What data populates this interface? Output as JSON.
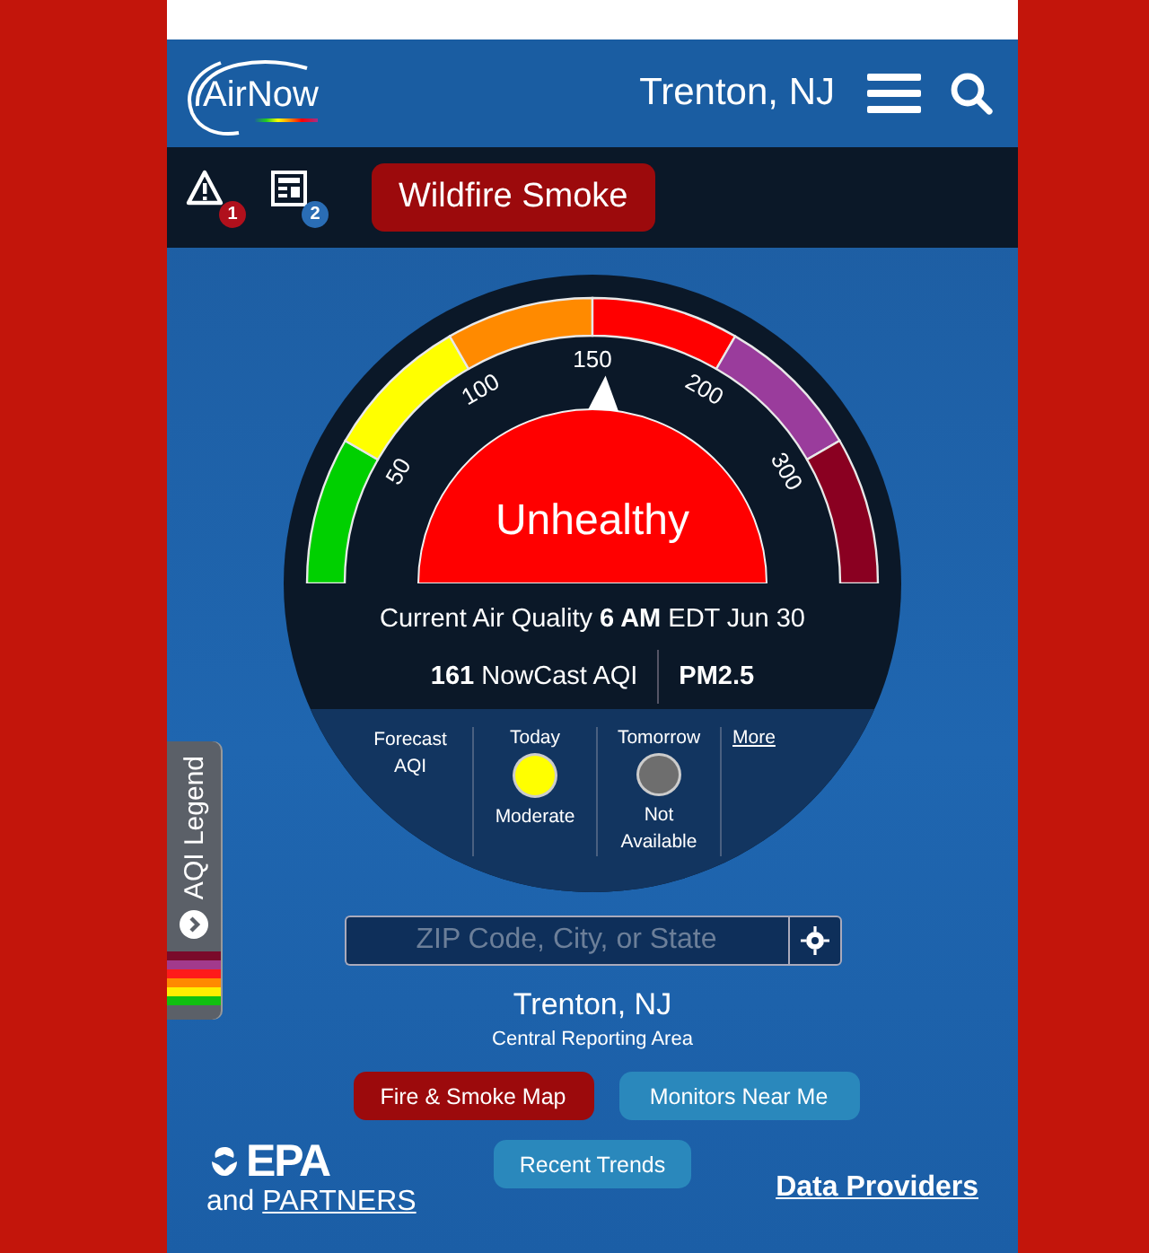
{
  "header": {
    "logo": "AirNow",
    "location": "Trenton, NJ"
  },
  "alerts": [
    {
      "kind": "warning",
      "count": "1",
      "color": "#b0101c"
    },
    {
      "kind": "notice",
      "count": "2",
      "color": "#2a6db5"
    }
  ],
  "banner_button": "Wildfire Smoke",
  "gauge": {
    "level": 0.52,
    "segments": [
      {
        "color": "#00d000"
      },
      {
        "color": "#ffff00"
      },
      {
        "color": "#ff8a00"
      },
      {
        "color": "#ff0000"
      },
      {
        "color": "#9a3c9c"
      },
      {
        "color": "#8a0021"
      }
    ],
    "ticks": [
      "50",
      "100",
      "150",
      "200",
      "300"
    ],
    "category": "Unhealthy"
  },
  "current": {
    "line": "Current Air Quality **6 AM** EDT Jun 30",
    "aqi": "**161** NowCast AQI",
    "pollutant": "PM2.5"
  },
  "forecast": {
    "title": "Forecast AQI",
    "days": [
      {
        "day": "Today",
        "color": "#ffff00",
        "category": "Moderate"
      },
      {
        "day": "Tomorrow",
        "color": "#6e6e6e",
        "category": "Not Available"
      }
    ],
    "more": "More"
  },
  "legend_tab": {
    "label": "AQI Legend",
    "colors": [
      {
        "color": "#7a0a2a"
      },
      {
        "color": "#a23a8c"
      },
      {
        "color": "#ff1a1a"
      },
      {
        "color": "#ff8a00"
      },
      {
        "color": "#ffee00"
      },
      {
        "color": "#10c010"
      }
    ]
  },
  "search": {
    "placeholder": "ZIP Code, City, or State"
  },
  "location": {
    "name": "Trenton, NJ",
    "area": "Central Reporting Area"
  },
  "buttons": [
    {
      "label": "Fire & Smoke Map",
      "kind": "alert"
    },
    {
      "label": "Monitors Near Me",
      "kind": "normal"
    },
    {
      "label": "Recent Trends",
      "kind": "normal"
    }
  ],
  "footer": {
    "logo": "EPA",
    "partners_prefix": "and",
    "partners_link": "PARTNERS",
    "data_link": "Data Providers"
  }
}
